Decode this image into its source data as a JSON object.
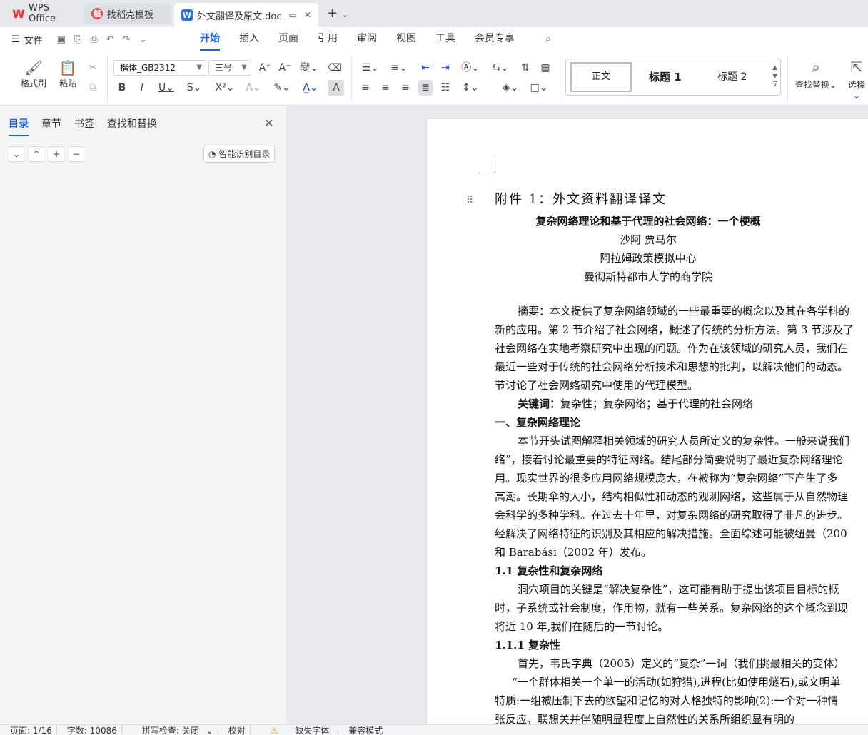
{
  "tabs": [
    {
      "label": "WPS Office",
      "icon": "wps-logo-icon"
    },
    {
      "label": "找稻壳模板",
      "icon": "daoke-icon"
    },
    {
      "label": "外文翻译及原文.doc",
      "icon": "word-doc-icon"
    }
  ],
  "menubar": {
    "file_label": "文件",
    "menus": [
      "开始",
      "插入",
      "页面",
      "引用",
      "审阅",
      "视图",
      "工具",
      "会员专享"
    ]
  },
  "ribbon": {
    "format_painter": "格式刷",
    "paste": "粘贴",
    "font_name": "楷体_GB2312",
    "font_size": "三号",
    "styles": {
      "normal": "正文",
      "h1": "标题 1",
      "h2": "标题 2"
    },
    "find_replace": "查找替换",
    "select": "选择"
  },
  "navpane": {
    "tabs": [
      "目录",
      "章节",
      "书签",
      "查找和替换"
    ],
    "smart_toc": "智能识别目录"
  },
  "document": {
    "appendix": "附件 1：外文资料翻译译文",
    "title": "复杂网络理论和基于代理的社会网络：一个梗概",
    "author": "沙阿 贾马尔",
    "org1": "阿拉姆政策模拟中心",
    "org2": "曼彻斯特都市大学的商学院",
    "abstract_lines": [
      "摘要：本文提供了复杂网络领域的一些最重要的概念以及其在各学科的",
      "新的应用。第 2 节介绍了社会网络，概述了传统的分析方法。第 3 节涉及了",
      "社会网络在实地考察研究中出现的问题。作为在该领域的研究人员，我们在",
      "最近一些对于传统的社会网络分析技术和思想的批判，以解决他们的动态。",
      "节讨论了社会网络研究中使用的代理模型。"
    ],
    "keywords_label": "关键词：",
    "keywords": "复杂性；复杂网络；基于代理的社会网络",
    "section1": "一、复杂网络理论",
    "section1_lines": [
      "本节开头试图解释相关领域的研究人员所定义的复杂性。一般来说我们",
      "络”，接着讨论最重要的特征网络。结尾部分简要说明了最近复杂网络理论",
      "用。现实世界的很多应用网络规模庞大，在被称为“复杂网络”下产生了多",
      "高潮。长期伞的大小，结构相似性和动态的观测网络，这些属于从自然物理",
      "会科学的多种学科。在过去十年里，对复杂网络的研究取得了非凡的进步。",
      "经解决了网络特征的识别及其相应的解决措施。全面综述可能被纽曼（200",
      "和 Barabási（2002 年）发布。"
    ],
    "section11": "1.1 复杂性和复杂网络",
    "section11_lines": [
      "洞穴项目的关键是“解决复杂性”，这可能有助于提出该项目目标的概",
      "时，子系统或社会制度，作用物，就有一些关系。复杂网络的这个概念到现",
      "将近 10 年,我们在随后的一节讨论。"
    ],
    "section111": "1.1.1 复杂性",
    "section111_lines": [
      "首先，韦氏字典（2005）定义的“复杂”一词（我们挑最相关的变体）",
      "“一个群体相关一个单一的活动(如狩猎),进程(比如使用燧石),或文明单",
      "特质:一组被压制下去的欲望和记忆的对人格独特的影响(2):一个对一种情",
      "张反应，联想关并伴随明显程度上自然性的关系所组织显有明的"
    ]
  },
  "statusbar": {
    "page": "页面: 1/16",
    "words": "字数: 10086",
    "spell": "拼写检查: 关闭",
    "proof": "校对",
    "missing_font": "缺失字体",
    "compat": "兼容模式"
  }
}
